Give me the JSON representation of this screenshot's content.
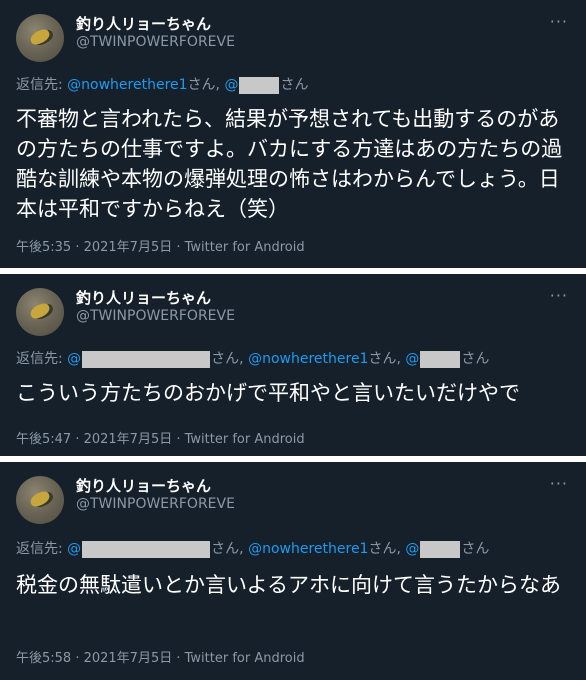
{
  "tweets": [
    {
      "author_name": "釣り人リョーちゃん",
      "author_handle": "@TWINPOWERFOREVE",
      "more_icon": "···",
      "reply_prefix": "返信先: ",
      "reply_segments": [
        {
          "text": "@nowherethere1",
          "mention": true
        },
        {
          "text": "さん, ",
          "mention": false
        },
        {
          "text": "@",
          "mention": true
        },
        {
          "redact_width": 40
        },
        {
          "text": "さん",
          "mention": false
        }
      ],
      "body": "不審物と言われたら、結果が予想されても出動するのがあの方たちの仕事ですよ。バカにする方達はあの方たちの過酷な訓練や本物の爆弾処理の怖さはわからんでしょう。日本は平和ですからねえ（笑）",
      "meta": "午後5:35 · 2021年7月5日 · Twitter for Android"
    },
    {
      "author_name": "釣り人リョーちゃん",
      "author_handle": "@TWINPOWERFOREVE",
      "more_icon": "···",
      "reply_prefix": "返信先: ",
      "reply_segments": [
        {
          "text": "@",
          "mention": true
        },
        {
          "redact_width": 128
        },
        {
          "text": "さん, ",
          "mention": false
        },
        {
          "text": "@nowherethere1",
          "mention": true
        },
        {
          "text": "さん, ",
          "mention": false
        },
        {
          "text": "@",
          "mention": true
        },
        {
          "redact_width": 40
        },
        {
          "text": "さん",
          "mention": false
        }
      ],
      "body": "こういう方たちのおかげで平和やと言いたいだけやで",
      "meta": "午後5:47 · 2021年7月5日 · Twitter for Android"
    },
    {
      "author_name": "釣り人リョーちゃん",
      "author_handle": "@TWINPOWERFOREVE",
      "more_icon": "···",
      "reply_prefix": "返信先: ",
      "reply_segments": [
        {
          "text": "@",
          "mention": true
        },
        {
          "redact_width": 128
        },
        {
          "text": "さん, ",
          "mention": false
        },
        {
          "text": "@nowherethere1",
          "mention": true
        },
        {
          "text": "さん, ",
          "mention": false
        },
        {
          "text": "@",
          "mention": true
        },
        {
          "redact_width": 40
        },
        {
          "text": "さん",
          "mention": false
        }
      ],
      "body": "税金の無駄遣いとか言いよるアホに向けて言うたからなあ",
      "meta": "午後5:58 · 2021年7月5日 · Twitter for Android"
    }
  ]
}
